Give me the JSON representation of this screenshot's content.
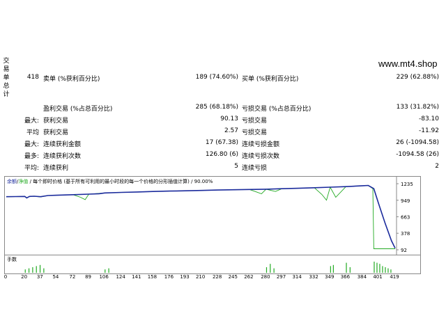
{
  "watermark": "www.mt4.shop",
  "side_label": [
    "交",
    "易",
    "单",
    "总",
    "计"
  ],
  "summary": {
    "total_trades": "418",
    "short_label": "卖单 (%获利百分比)",
    "short_value": "189 (74.60%)",
    "long_label": "买单 (%获利百分比)",
    "long_value": "229 (62.88%)",
    "profit_trades_label": "盈利交易 (%占总百分比)",
    "profit_trades_value": "285 (68.18%)",
    "loss_trades_label": "亏损交易 (%占总百分比)",
    "loss_trades_value": "133 (31.82%)"
  },
  "rows": [
    {
      "prefix": "最大:",
      "l_label": "获利交易",
      "l_value": "90.13",
      "r_label": "亏损交易",
      "r_value": "-83.10"
    },
    {
      "prefix": "平均",
      "l_label": "获利交易",
      "l_value": "2.57",
      "r_label": "亏损交易",
      "r_value": "-11.92"
    },
    {
      "prefix": "最大:",
      "l_label": "连续获利金额",
      "l_value": "17 (67.38)",
      "r_label": "连续亏损金额",
      "r_value": "26 (-1094.58)"
    },
    {
      "prefix": "最多:",
      "l_label": "连续获利次数",
      "l_value": "126.80 (6)",
      "r_label": "连续亏损次数",
      "r_value": "-1094.58 (26)"
    },
    {
      "prefix": "平均:",
      "l_label": "连续获利",
      "l_value": "5",
      "r_label": "连续亏损",
      "r_value": "2"
    }
  ],
  "chart": {
    "legend_balance": "余额",
    "legend_sep": "/",
    "legend_equity": "净值",
    "caption": "/ 每个即时价格 (基于所有可利用的最小时段的每一个价格的分形插值计算) / 90.00%",
    "y_ticks": [
      "1235",
      "949",
      "663",
      "378",
      "92"
    ],
    "x_ticks": [
      "0",
      "20",
      "37",
      "54",
      "72",
      "89",
      "106",
      "124",
      "141",
      "158",
      "176",
      "193",
      "210",
      "228",
      "245",
      "262",
      "280",
      "297",
      "314",
      "332",
      "349",
      "366",
      "384",
      "401",
      "419"
    ],
    "volume_label": "手数",
    "colors": {
      "balance": "#1a2a9c",
      "equity": "#22aa22",
      "volume": "#22aa22"
    }
  },
  "chart_data": {
    "type": "line",
    "ylim": [
      92,
      1235
    ],
    "xlim": [
      0,
      419
    ],
    "series": [
      {
        "name": "余额",
        "x": [
          0,
          10,
          20,
          22,
          25,
          30,
          37,
          45,
          54,
          72,
          89,
          100,
          106,
          124,
          141,
          158,
          176,
          193,
          210,
          228,
          245,
          262,
          280,
          297,
          314,
          332,
          349,
          366,
          384,
          390,
          396,
          401,
          408,
          415,
          419
        ],
        "y": [
          1010,
          1012,
          1015,
          990,
          1015,
          1018,
          1010,
          1030,
          1035,
          1045,
          1055,
          1062,
          1075,
          1085,
          1092,
          1100,
          1108,
          1112,
          1118,
          1125,
          1130,
          1135,
          1140,
          1148,
          1155,
          1165,
          1175,
          1185,
          1200,
          1205,
          1150,
          900,
          560,
          250,
          120
        ]
      },
      {
        "name": "净值",
        "x": [
          0,
          10,
          20,
          22,
          25,
          30,
          37,
          45,
          54,
          72,
          80,
          85,
          89,
          106,
          124,
          141,
          158,
          176,
          193,
          210,
          228,
          245,
          262,
          270,
          275,
          280,
          290,
          297,
          314,
          332,
          340,
          345,
          349,
          355,
          366,
          384,
          390,
          395,
          396,
          401,
          410,
          419
        ],
        "y": [
          1010,
          1012,
          1015,
          985,
          1015,
          1018,
          1005,
          1030,
          1035,
          1045,
          1000,
          960,
          1055,
          1075,
          1085,
          1092,
          1100,
          1108,
          1112,
          1118,
          1125,
          1130,
          1135,
          1090,
          1060,
          1140,
          1100,
          1148,
          1155,
          1165,
          1050,
          950,
          1175,
          1000,
          1185,
          1200,
          1205,
          1150,
          110,
          110,
          110,
          110
        ]
      }
    ],
    "volume": {
      "x": [
        20,
        24,
        28,
        32,
        36,
        40,
        106,
        110,
        280,
        284,
        288,
        349,
        352,
        366,
        370,
        396,
        399,
        402,
        405,
        408,
        411,
        414
      ],
      "v": [
        0.3,
        0.4,
        0.5,
        0.6,
        0.7,
        0.4,
        0.3,
        0.4,
        0.5,
        0.8,
        0.4,
        0.6,
        0.7,
        0.9,
        0.5,
        1.0,
        0.9,
        0.8,
        0.6,
        0.5,
        0.4,
        0.3
      ]
    }
  }
}
